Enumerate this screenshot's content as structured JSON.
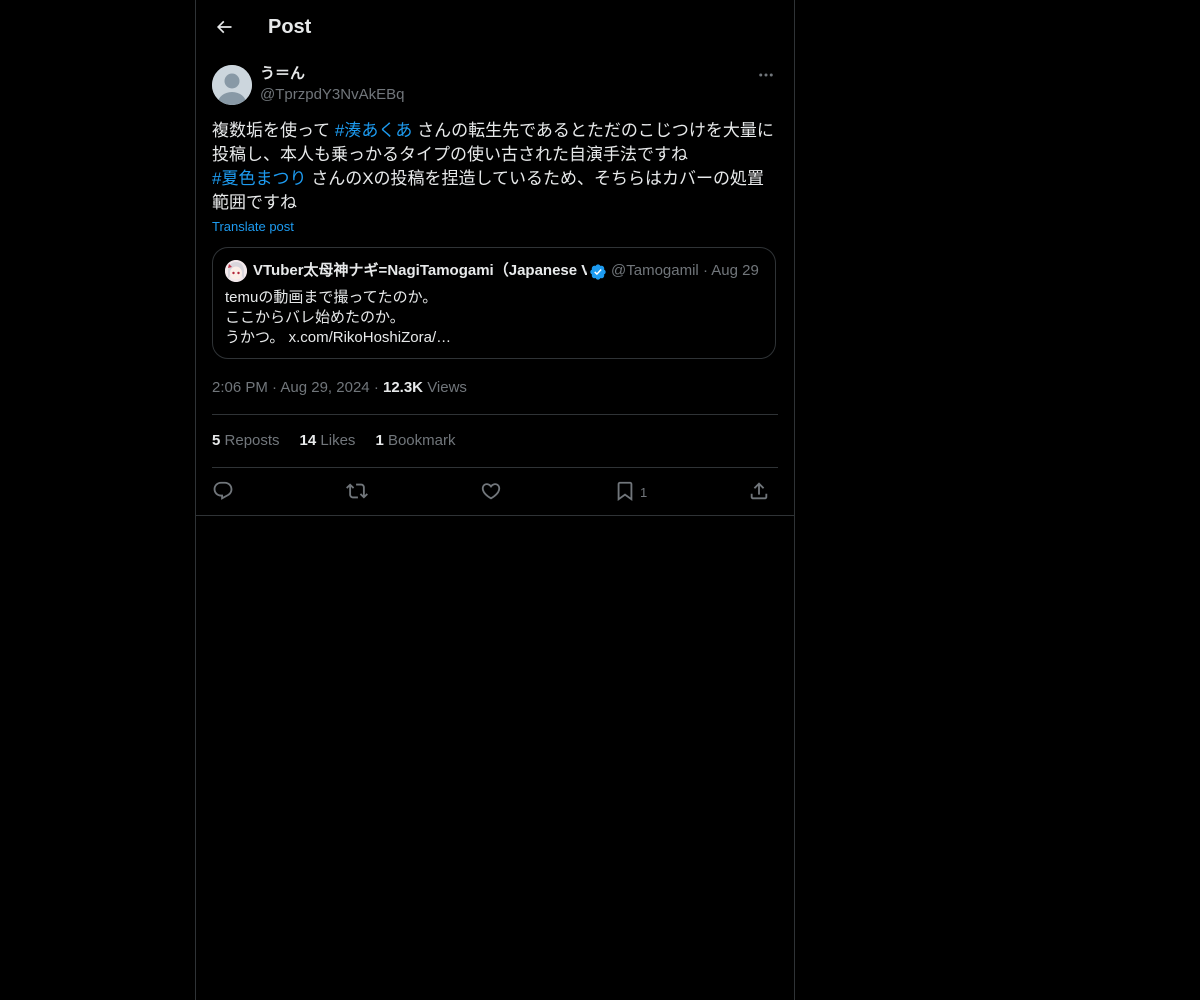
{
  "header": {
    "title": "Post"
  },
  "post": {
    "display_name": "う＝ん",
    "handle": "@TprzpdY3NvAkEBq",
    "text": {
      "part1": "複数垢を使って ",
      "hashtag1": "#湊あくあ",
      "part2": " さんの転生先であるとただのこじつけを大量に投稿し、本人も乗っかるタイプの使い古された自演手法ですね",
      "hashtag2": "#夏色まつり",
      "part3": " さんのXの投稿を捏造しているため、そちらはカバーの処置範囲ですね"
    },
    "translate_label": "Translate post",
    "quote": {
      "display_name": "VTuber太母神ナギ=NagiTamogami（Japanese VTuber）",
      "handle": "@Tamogamil",
      "separator": "·",
      "date": "Aug 29",
      "lines": [
        "temuの動画まで撮ってたのか。",
        "ここからバレ始めたのか。",
        "うかつ。 x.com/RikoHoshiZora/…"
      ]
    },
    "meta": {
      "time": "2:06 PM",
      "date": "Aug 29, 2024",
      "separator": "·",
      "views_count": "12.3K",
      "views_label": "Views"
    },
    "stats": {
      "reposts_count": "5",
      "reposts_label": "Reposts",
      "likes_count": "14",
      "likes_label": "Likes",
      "bookmarks_count": "1",
      "bookmarks_label": "Bookmark"
    },
    "actions": {
      "bookmark_count": "1"
    }
  },
  "colors": {
    "background": "#000000",
    "text": "#e7e9ea",
    "muted": "#71767b",
    "accent": "#1d9bf0",
    "border": "#2f3336"
  },
  "icons": [
    "back-arrow-icon",
    "more-icon",
    "verified-icon",
    "reply-icon",
    "repost-icon",
    "like-icon",
    "bookmark-icon",
    "share-icon"
  ]
}
